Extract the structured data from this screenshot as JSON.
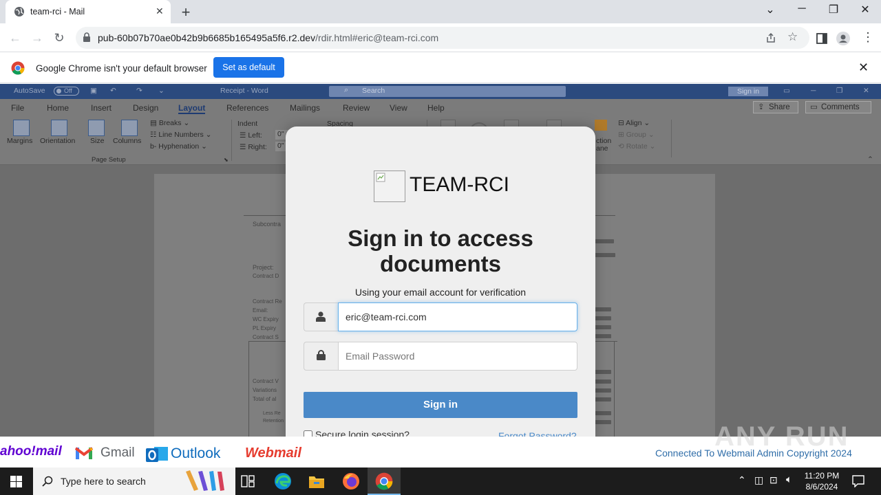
{
  "browser": {
    "tab_title": "team-rci - Mail",
    "new_tab_label": "+",
    "url_host": "pub-60b07b70ae0b42b9b6685b165495a5f6.r2.dev",
    "url_rest": "/rdir.html#eric@team-rci.com"
  },
  "infobar": {
    "message": "Google Chrome isn't your default browser",
    "button_label": "Set as default"
  },
  "word": {
    "autosave_label": "AutoSave",
    "autosave_state": "Off",
    "doc_title": "Receipt - Word",
    "search_placeholder": "Search",
    "sign_in_label": "Sign in",
    "menu": [
      "File",
      "Home",
      "Insert",
      "Design",
      "Layout",
      "References",
      "Mailings",
      "Review",
      "View",
      "Help"
    ],
    "share_label": "Share",
    "comments_label": "Comments",
    "ribbon": {
      "margins": "Margins",
      "orientation": "Orientation",
      "size": "Size",
      "columns": "Columns",
      "breaks": "Breaks",
      "line_numbers": "Line Numbers",
      "hyphenation": "Hyphenation",
      "page_setup": "Page Setup",
      "indent": "Indent",
      "indent_left": "Left:",
      "indent_right": "Right:",
      "indent_value": "0\"",
      "spacing": "Spacing",
      "align": "Align",
      "group": "Group",
      "rotate": "Rotate",
      "selection_pane_fragment": "ction",
      "selection_pane_fragment2": "ane"
    },
    "doc_fragments": {
      "subcontract": "Subcontra",
      "project": "Project:",
      "contract": "Contract D",
      "contract_re": "Contract Re",
      "email": "Email:",
      "wc_expiry": "WC Expiry",
      "pl_expiry": "PL Expiry",
      "contract_s": "Contract S",
      "contract_v": "Contract V",
      "variations": "Variations",
      "total": "Total of al",
      "less": "Less Re",
      "retention": "Retention"
    }
  },
  "modal": {
    "logo_text": "TEAM-RCI",
    "heading": "Sign in to access documents",
    "subheading": "Using your email account for verification",
    "email_value": "eric@team-rci.com",
    "password_placeholder": "Email Password",
    "sign_in_button": "Sign in",
    "secure_label": "Secure login session?",
    "forgot_label": "Forgot Password?"
  },
  "footer": {
    "yahoo": "ahoo!mail",
    "gmail": "Gmail",
    "outlook": "Outlook",
    "webmail": "Webmail",
    "copyright": "Connected To Webmail Admin Copyright 2024",
    "watermark": "ANY RUN"
  },
  "taskbar": {
    "search_placeholder": "Type here to search",
    "time": "11:20 PM",
    "date": "8/6/2024"
  },
  "colors": {
    "chrome_blue": "#1a73e8",
    "word_blue": "#2b4a7e",
    "sign_in_blue": "#4a89c8",
    "outlook_blue": "#0f6cbd",
    "webmail_red": "#e63c2f",
    "yahoo_purple": "#6001d2"
  }
}
